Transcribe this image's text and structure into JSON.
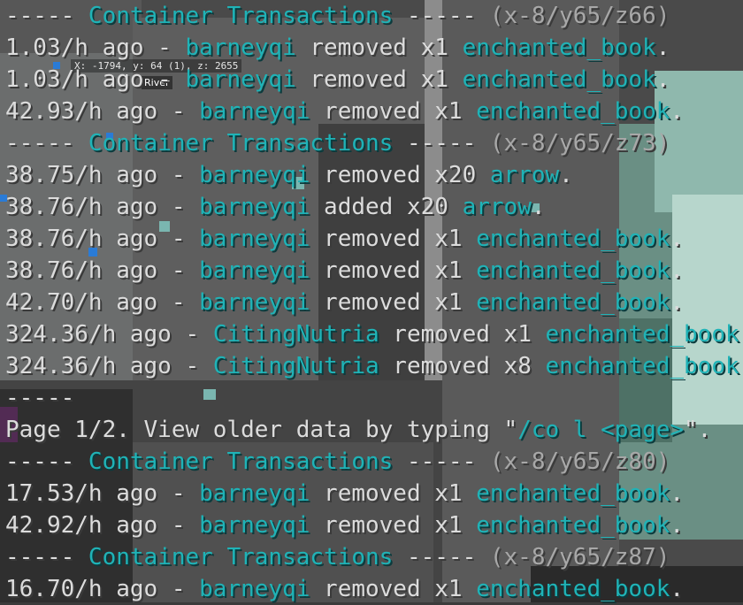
{
  "hud": {
    "coords": "X: -1794, y: 64 (1), z: 2655",
    "biome": "River"
  },
  "chat": [
    {
      "parts": [
        {
          "t": "----- ",
          "c": "w"
        },
        {
          "t": "Container Transactions",
          "c": "c"
        },
        {
          "t": " ----- ",
          "c": "w"
        },
        {
          "t": "(x-8/y65/z66)",
          "c": "g"
        }
      ]
    },
    {
      "parts": [
        {
          "t": "1.03/h ago - ",
          "c": "w"
        },
        {
          "t": "barneyqi",
          "c": "c"
        },
        {
          "t": " removed x1 ",
          "c": "w"
        },
        {
          "t": "enchanted_book",
          "c": "c"
        },
        {
          "t": ".",
          "c": "w"
        }
      ]
    },
    {
      "parts": [
        {
          "t": "1.03/h ago - ",
          "c": "w"
        },
        {
          "t": "barneyqi",
          "c": "c"
        },
        {
          "t": " removed x1 ",
          "c": "w"
        },
        {
          "t": "enchanted_book",
          "c": "c"
        },
        {
          "t": ".",
          "c": "w"
        }
      ]
    },
    {
      "parts": [
        {
          "t": "42.93/h ago - ",
          "c": "w"
        },
        {
          "t": "barneyqi",
          "c": "c"
        },
        {
          "t": " removed x1 ",
          "c": "w"
        },
        {
          "t": "enchanted_book",
          "c": "c"
        },
        {
          "t": ".",
          "c": "w"
        }
      ]
    },
    {
      "parts": [
        {
          "t": "----- ",
          "c": "w"
        },
        {
          "t": "Container Transactions",
          "c": "c"
        },
        {
          "t": " ----- ",
          "c": "w"
        },
        {
          "t": "(x-8/y65/z73)",
          "c": "g"
        }
      ]
    },
    {
      "parts": [
        {
          "t": "38.75/h ago - ",
          "c": "w"
        },
        {
          "t": "barneyqi",
          "c": "c"
        },
        {
          "t": " removed x20 ",
          "c": "w"
        },
        {
          "t": "arrow",
          "c": "c"
        },
        {
          "t": ".",
          "c": "w"
        }
      ]
    },
    {
      "parts": [
        {
          "t": "38.76/h ago - ",
          "c": "w"
        },
        {
          "t": "barneyqi",
          "c": "c"
        },
        {
          "t": " added x20 ",
          "c": "w"
        },
        {
          "t": "arrow",
          "c": "c"
        },
        {
          "t": ".",
          "c": "w"
        }
      ]
    },
    {
      "parts": [
        {
          "t": "38.76/h ago - ",
          "c": "w"
        },
        {
          "t": "barneyqi",
          "c": "c"
        },
        {
          "t": " removed x1 ",
          "c": "w"
        },
        {
          "t": "enchanted_book",
          "c": "c"
        },
        {
          "t": ".",
          "c": "w"
        }
      ]
    },
    {
      "parts": [
        {
          "t": "38.76/h ago - ",
          "c": "w"
        },
        {
          "t": "barneyqi",
          "c": "c"
        },
        {
          "t": " removed x1 ",
          "c": "w"
        },
        {
          "t": "enchanted_book",
          "c": "c"
        },
        {
          "t": ".",
          "c": "w"
        }
      ]
    },
    {
      "parts": [
        {
          "t": "42.70/h ago - ",
          "c": "w"
        },
        {
          "t": "barneyqi",
          "c": "c"
        },
        {
          "t": " removed x1 ",
          "c": "w"
        },
        {
          "t": "enchanted_book",
          "c": "c"
        },
        {
          "t": ".",
          "c": "w"
        }
      ]
    },
    {
      "parts": [
        {
          "t": "324.36/h ago - ",
          "c": "w"
        },
        {
          "t": "CitingNutria",
          "c": "c"
        },
        {
          "t": " removed x1 ",
          "c": "w"
        },
        {
          "t": "enchanted_book",
          "c": "c"
        },
        {
          "t": ".",
          "c": "w"
        }
      ]
    },
    {
      "parts": [
        {
          "t": "324.36/h ago - ",
          "c": "w"
        },
        {
          "t": "CitingNutria",
          "c": "c"
        },
        {
          "t": " removed x8 ",
          "c": "w"
        },
        {
          "t": "enchanted_book",
          "c": "c"
        },
        {
          "t": ".",
          "c": "w"
        }
      ]
    },
    {
      "parts": [
        {
          "t": "-----",
          "c": "w"
        }
      ]
    },
    {
      "parts": [
        {
          "t": "Page 1/2. View older data by typing \"",
          "c": "w"
        },
        {
          "t": "/co l <page>",
          "c": "c"
        },
        {
          "t": "\".",
          "c": "w"
        }
      ]
    },
    {
      "parts": [
        {
          "t": "----- ",
          "c": "w"
        },
        {
          "t": "Container Transactions",
          "c": "c"
        },
        {
          "t": " ----- ",
          "c": "w"
        },
        {
          "t": "(x-8/y65/z80)",
          "c": "g"
        }
      ]
    },
    {
      "parts": [
        {
          "t": "17.53/h ago - ",
          "c": "w"
        },
        {
          "t": "barneyqi",
          "c": "c"
        },
        {
          "t": " removed x1 ",
          "c": "w"
        },
        {
          "t": "enchanted_book",
          "c": "c"
        },
        {
          "t": ".",
          "c": "w"
        }
      ]
    },
    {
      "parts": [
        {
          "t": "42.92/h ago - ",
          "c": "w"
        },
        {
          "t": "barneyqi",
          "c": "c"
        },
        {
          "t": " removed x1 ",
          "c": "w"
        },
        {
          "t": "enchanted_book",
          "c": "c"
        },
        {
          "t": ".",
          "c": "w"
        }
      ]
    },
    {
      "parts": [
        {
          "t": "----- ",
          "c": "w"
        },
        {
          "t": "Container Transactions",
          "c": "c"
        },
        {
          "t": " ----- ",
          "c": "w"
        },
        {
          "t": "(x-8/y65/z87)",
          "c": "g"
        }
      ]
    },
    {
      "parts": [
        {
          "t": "16.70/h ago - ",
          "c": "w"
        },
        {
          "t": "barneyqi",
          "c": "c"
        },
        {
          "t": " removed x1 ",
          "c": "w"
        },
        {
          "t": "enchanted_book",
          "c": "c"
        },
        {
          "t": ".",
          "c": "w"
        }
      ]
    }
  ]
}
